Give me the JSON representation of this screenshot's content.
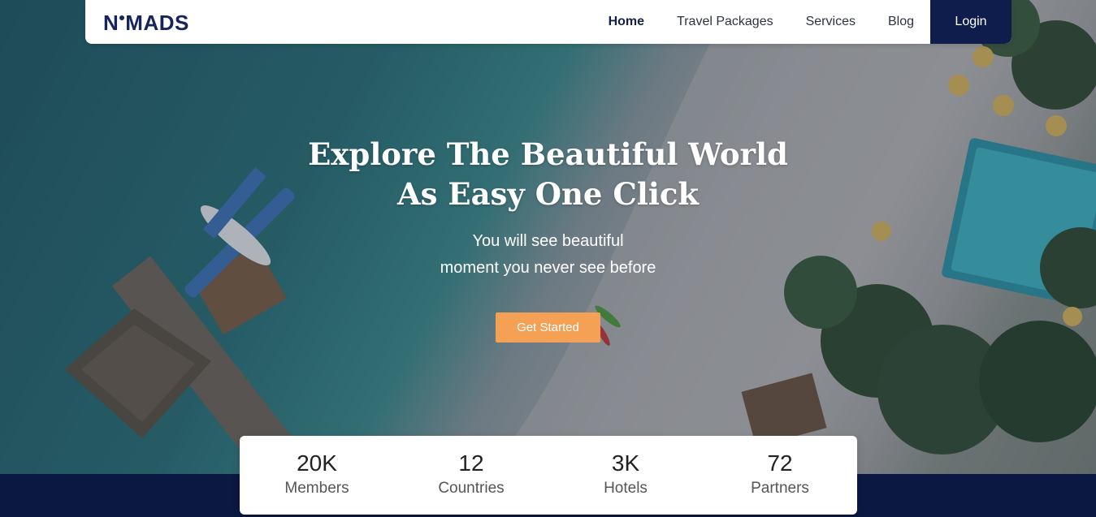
{
  "brand": {
    "logo_left": "N",
    "logo_right": "MADS"
  },
  "nav": {
    "items": [
      {
        "label": "Home",
        "active": true
      },
      {
        "label": "Travel Packages",
        "active": false
      },
      {
        "label": "Services",
        "active": false
      },
      {
        "label": "Blog",
        "active": false
      }
    ],
    "login_label": "Login"
  },
  "hero": {
    "title_line1": "Explore The Beautiful World",
    "title_line2": "As Easy One Click",
    "subtitle_line1": "You will see beautiful",
    "subtitle_line2": "moment you never see before",
    "cta_label": "Get Started"
  },
  "stats": [
    {
      "value": "20K",
      "label": "Members"
    },
    {
      "value": "12",
      "label": "Countries"
    },
    {
      "value": "3K",
      "label": "Hotels"
    },
    {
      "value": "72",
      "label": "Partners"
    }
  ],
  "colors": {
    "brand_navy": "#0f1d4c",
    "accent_orange": "#f4a155",
    "footer_band": "#0b1842"
  },
  "icons": [
    "logo-dot-icon"
  ]
}
